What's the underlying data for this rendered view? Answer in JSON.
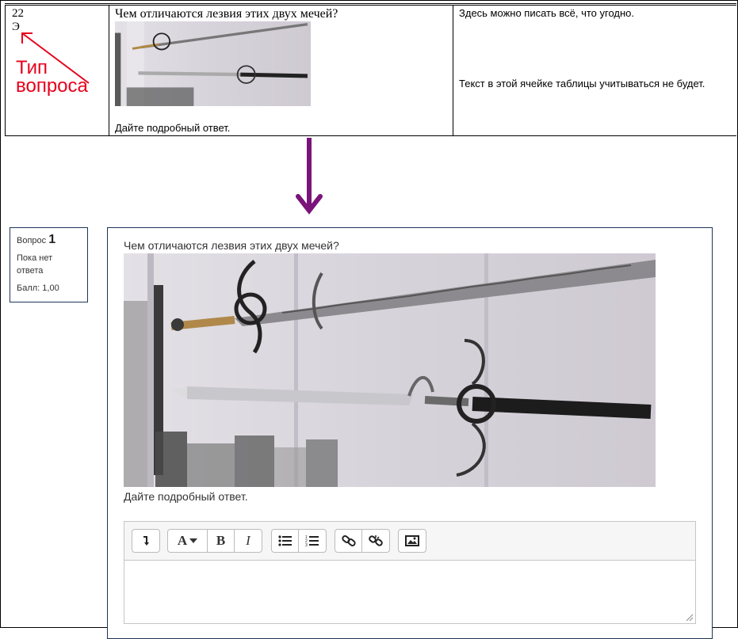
{
  "source": {
    "number": "22",
    "type_code": "Э",
    "question": "Чем отличаются лезвия этих двух мечей?",
    "hint": "Дайте подробный ответ.",
    "note1": "Здесь можно писать всё, что угодно.",
    "note2": "Текст в этой ячейке таблицы учитываться не будет."
  },
  "annotation": {
    "line1": "Тип",
    "line2": "вопроса",
    "color": "#e8001c"
  },
  "transition_arrow_color": "#7a137a",
  "quiz": {
    "info": {
      "label": "Вопрос",
      "number": "1",
      "state_line1": "Пока нет",
      "state_line2": "ответа",
      "grade": "Балл: 1,00"
    },
    "question": "Чем отличаются лезвия этих двух мечей?",
    "hint": "Дайте подробный ответ.",
    "editor": {
      "buttons": [
        "show-more-icon",
        "font-color-icon",
        "bold-icon",
        "italic-icon",
        "unordered-list-icon",
        "ordered-list-icon",
        "link-icon",
        "unlink-icon",
        "image-icon"
      ],
      "bold": "B",
      "italic": "I",
      "font": "A"
    }
  }
}
